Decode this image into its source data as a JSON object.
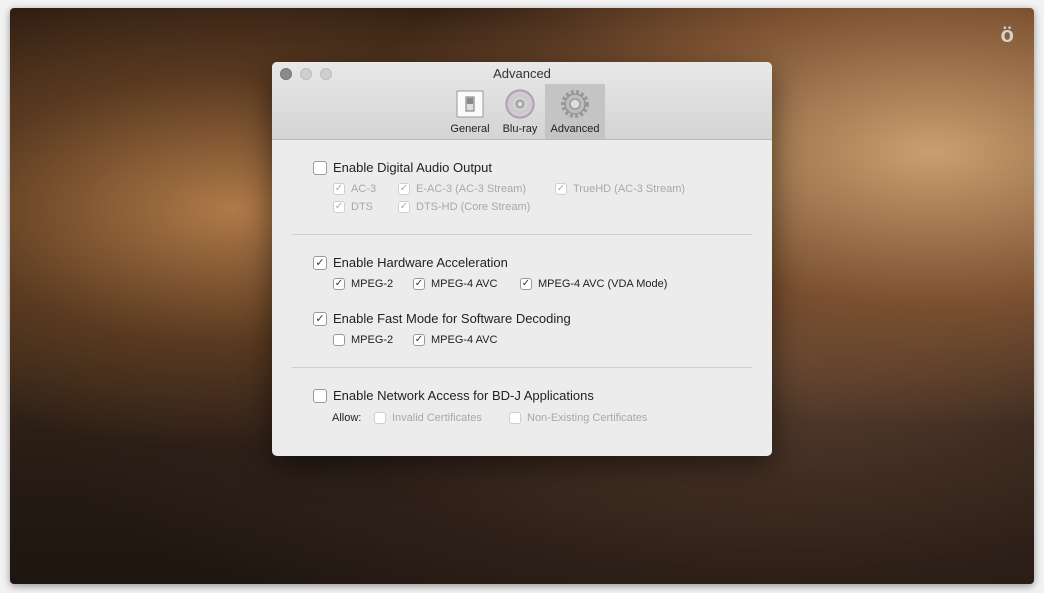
{
  "app": {
    "logo": "ö"
  },
  "dialog": {
    "title": "Advanced",
    "tabs": [
      {
        "label": "General"
      },
      {
        "label": "Blu-ray"
      },
      {
        "label": "Advanced"
      }
    ],
    "audio": {
      "label": "Enable Digital Audio Output",
      "checked": false,
      "options": [
        {
          "label": "AC-3",
          "checked": true
        },
        {
          "label": "E-AC-3 (AC-3 Stream)",
          "checked": true
        },
        {
          "label": "TrueHD (AC-3 Stream)",
          "checked": true
        },
        {
          "label": "DTS",
          "checked": true
        },
        {
          "label": "DTS-HD (Core Stream)",
          "checked": true
        }
      ]
    },
    "hw": {
      "label": "Enable Hardware Acceleration",
      "checked": true,
      "options": [
        {
          "label": "MPEG-2",
          "checked": true
        },
        {
          "label": "MPEG-4 AVC",
          "checked": true
        },
        {
          "label": "MPEG-4 AVC (VDA Mode)",
          "checked": true
        }
      ]
    },
    "fast": {
      "label": "Enable Fast Mode for Software Decoding",
      "checked": true,
      "options": [
        {
          "label": "MPEG-2",
          "checked": false
        },
        {
          "label": "MPEG-4 AVC",
          "checked": true
        }
      ]
    },
    "net": {
      "label": "Enable Network Access for BD-J Applications",
      "checked": false,
      "allow_label": "Allow:",
      "options": [
        {
          "label": "Invalid Certificates",
          "checked": false
        },
        {
          "label": "Non-Existing Certificates",
          "checked": false
        }
      ]
    }
  }
}
